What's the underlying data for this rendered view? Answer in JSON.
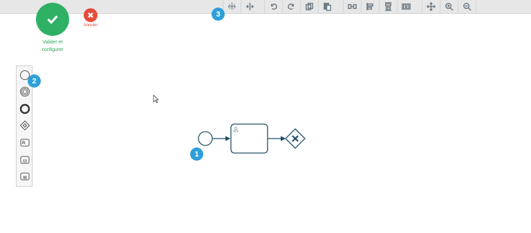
{
  "actions": {
    "validate_label": "Valider et configurer",
    "cancel_label": "Annuler",
    "colors": {
      "validate": "#2fb165",
      "cancel": "#e74c3c"
    }
  },
  "toolbar": {
    "icons": [
      "space-tool-icon",
      "split-icon",
      "undo-icon",
      "redo-icon",
      "copy-icon",
      "paste-icon",
      "distribute-horizontal-icon",
      "align-left-icon",
      "align-center-icon",
      "distribute-vertical-icon",
      "fit-view-icon",
      "zoom-in-icon",
      "zoom-out-icon"
    ]
  },
  "palette": {
    "items": [
      "start-event-icon",
      "intermediate-event-icon",
      "end-event-icon",
      "gateway-icon",
      "user-task-icon",
      "service-task-icon",
      "sub-process-icon"
    ]
  },
  "steps": {
    "badge_1": "1",
    "badge_2": "2",
    "badge_3": "3",
    "color": "#2d9fd9"
  },
  "diagram": {
    "elements": [
      "start-event",
      "sequence-flow",
      "user-task",
      "sequence-flow",
      "exclusive-gateway"
    ],
    "stroke_color": "#1d4e66"
  }
}
